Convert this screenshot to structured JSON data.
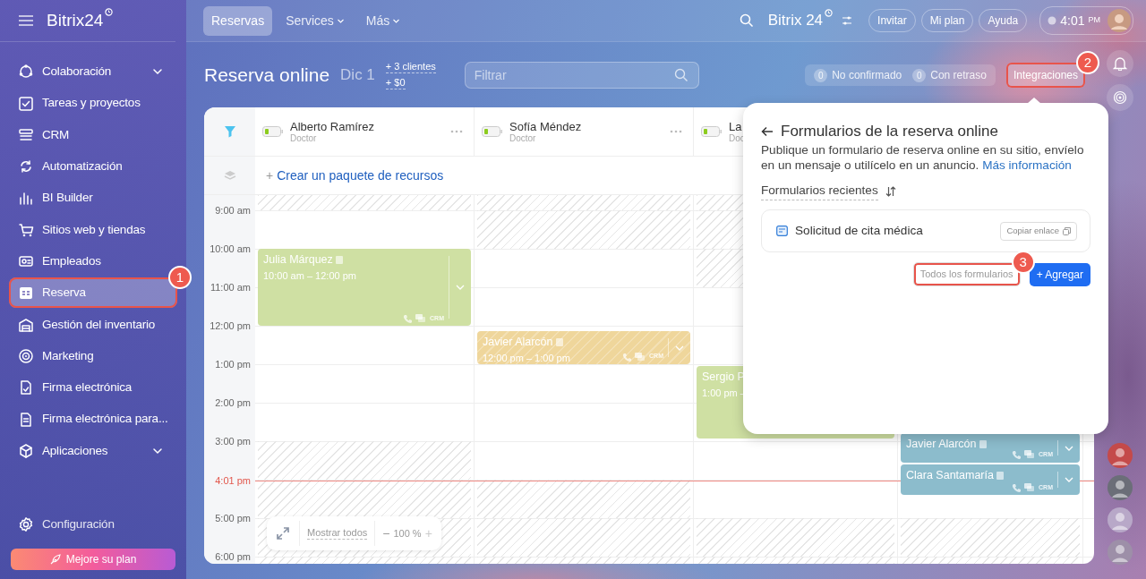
{
  "sidebar": {
    "logo": "Bitrix24",
    "items": [
      {
        "label": "Colaboración",
        "expandable": true,
        "selected": false
      },
      {
        "label": "Tareas y proyectos",
        "expandable": false,
        "selected": false
      },
      {
        "label": "CRM",
        "expandable": false,
        "selected": false
      },
      {
        "label": "Automatización",
        "expandable": false,
        "selected": false
      },
      {
        "label": "BI Builder",
        "expandable": false,
        "selected": false
      },
      {
        "label": "Sitios web y tiendas",
        "expandable": false,
        "selected": false
      },
      {
        "label": "Empleados",
        "expandable": false,
        "selected": false
      },
      {
        "label": "Reserva",
        "expandable": false,
        "selected": true,
        "annotation": "1"
      },
      {
        "label": "Gestión del inventario",
        "expandable": false,
        "selected": false
      },
      {
        "label": "Marketing",
        "expandable": false,
        "selected": false
      },
      {
        "label": "Firma electrónica",
        "expandable": false,
        "selected": false
      },
      {
        "label": "Firma electrónica para...",
        "expandable": false,
        "selected": false
      },
      {
        "label": "Aplicaciones",
        "expandable": true,
        "selected": false
      }
    ],
    "settings": "Configuración",
    "upgrade": "Mejore su plan"
  },
  "topbar": {
    "tabs": [
      {
        "label": "Reservas",
        "selected": true,
        "dropdown": false
      },
      {
        "label": "Services",
        "selected": false,
        "dropdown": true
      },
      {
        "label": "Más",
        "selected": false,
        "dropdown": true
      }
    ],
    "logo": "Bitrix 24",
    "buttons": [
      "Invitar",
      "Mi plan",
      "Ayuda"
    ],
    "clock": {
      "time": "4:01",
      "ampm": "PM"
    }
  },
  "toolbar": {
    "title": "Reserva online",
    "date": "Dic 1",
    "stats": [
      "+ 3 clientes",
      "+ $0"
    ],
    "filter": {
      "placeholder": "Filtrar"
    },
    "counters": [
      {
        "count": "0",
        "label": "No confirmado"
      },
      {
        "count": "0",
        "label": "Con retraso"
      }
    ],
    "integrations": {
      "label": "Integraciones",
      "annotation": "2"
    }
  },
  "calendar": {
    "resources": [
      {
        "name": "Alberto Ramírez",
        "role": "Doctor"
      },
      {
        "name": "Sofía Méndez",
        "role": "Doctor"
      },
      {
        "name": "La",
        "role": "Doc"
      }
    ],
    "create_package": {
      "icon": "+",
      "label": "Crear un paquete de recursos"
    },
    "hours": [
      "9:00 am",
      "10:00 am",
      "11:00 am",
      "12:00 pm",
      "1:00 pm",
      "2:00 pm",
      "3:00 pm",
      "5:00 pm",
      "6:00 pm"
    ],
    "now": "4:01 pm",
    "columns": [
      {
        "unavailable": [
          true,
          false,
          false,
          false,
          false,
          false,
          false,
          true,
          true,
          true,
          true
        ],
        "bookings": [
          {
            "name": "Julia Márquez",
            "time": "10:00 am – 12:00 pm",
            "crm": "CRM",
            "color": "#cfe0a3",
            "hatched": false
          }
        ]
      },
      {
        "unavailable": [
          true,
          true,
          false,
          false,
          false,
          false,
          false,
          false,
          true,
          true,
          true
        ],
        "bookings": [
          {
            "name": "Javier Alarcón",
            "time": "12:00 pm – 1:00 pm",
            "crm": "CRM",
            "color": "#efd69b",
            "hatched": true
          }
        ]
      },
      {
        "unavailable": [
          true,
          true,
          true,
          false,
          false,
          false,
          false,
          false,
          false,
          true,
          true
        ],
        "bookings": [
          {
            "name": "Sergio P",
            "time": "1:00 pm –",
            "color": "#cfe0a3",
            "hatched": false
          }
        ]
      },
      {
        "unavailable": [
          false,
          false,
          false,
          false,
          false,
          false,
          false,
          false,
          false,
          true,
          true
        ],
        "bookings": [
          {
            "name": "Javier Alarcón",
            "crm": "CRM",
            "color": "#8cbccc",
            "hatched": false
          },
          {
            "name": "Clara Santamaría",
            "crm": "CRM",
            "color": "#8cbccc",
            "hatched": false
          }
        ]
      }
    ],
    "zoom": {
      "show_all": "Mostrar todos",
      "minus": "−",
      "value": "100 %",
      "plus": "+"
    }
  },
  "popup": {
    "title": "Formularios de la reserva online",
    "description": "Publique un formulario de reserva online en su sitio, envíelo en un mensaje o utilícelo en un anuncio.",
    "link": "Más información",
    "recent_label": "Formularios recientes",
    "forms": [
      {
        "name": "Solicitud de cita médica",
        "copy": "Copiar enlace"
      }
    ],
    "all_button": {
      "label": "Todos los formularios",
      "annotation": "3"
    },
    "add_button": "+ Agregar"
  }
}
